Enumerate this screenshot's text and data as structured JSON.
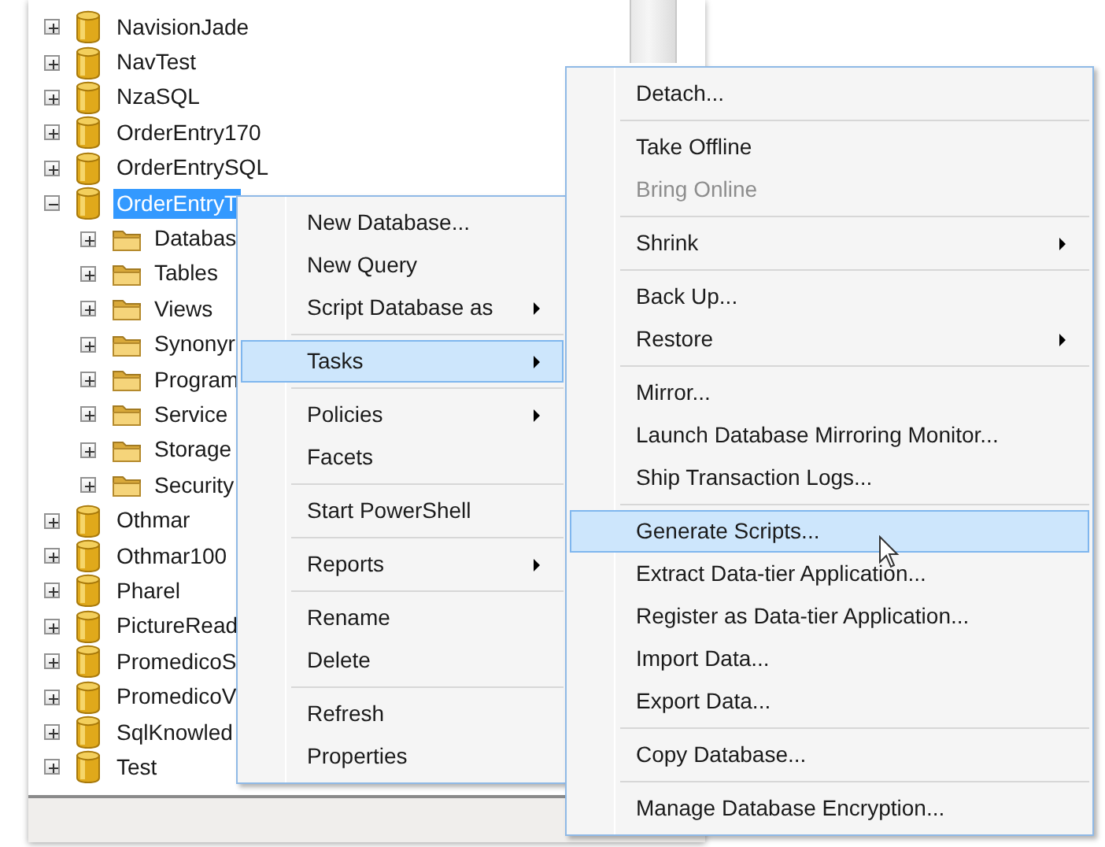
{
  "tree": [
    {
      "label": "NavisionJade",
      "kind": "database",
      "expanded": false,
      "selected": false
    },
    {
      "label": "NavTest",
      "kind": "database",
      "expanded": false,
      "selected": false
    },
    {
      "label": "NzaSQL",
      "kind": "database",
      "expanded": false,
      "selected": false
    },
    {
      "label": "OrderEntry170",
      "kind": "database",
      "expanded": false,
      "selected": false
    },
    {
      "label": "OrderEntrySQL",
      "kind": "database",
      "expanded": false,
      "selected": false
    },
    {
      "label": "OrderEntryT",
      "kind": "database",
      "expanded": true,
      "selected": true,
      "children": [
        {
          "label": "Databas",
          "kind": "folder",
          "expanded": false,
          "selected": false
        },
        {
          "label": "Tables",
          "kind": "folder",
          "expanded": false,
          "selected": false
        },
        {
          "label": "Views",
          "kind": "folder",
          "expanded": false,
          "selected": false
        },
        {
          "label": "Synonyr",
          "kind": "folder",
          "expanded": false,
          "selected": false
        },
        {
          "label": "Program",
          "kind": "folder",
          "expanded": false,
          "selected": false
        },
        {
          "label": "Service",
          "kind": "folder",
          "expanded": false,
          "selected": false
        },
        {
          "label": "Storage",
          "kind": "folder",
          "expanded": false,
          "selected": false
        },
        {
          "label": "Security",
          "kind": "folder",
          "expanded": false,
          "selected": false
        }
      ]
    },
    {
      "label": "Othmar",
      "kind": "database",
      "expanded": false,
      "selected": false
    },
    {
      "label": "Othmar100",
      "kind": "database",
      "expanded": false,
      "selected": false
    },
    {
      "label": "Pharel",
      "kind": "database",
      "expanded": false,
      "selected": false
    },
    {
      "label": "PictureRead",
      "kind": "database",
      "expanded": false,
      "selected": false
    },
    {
      "label": "PromedicoS",
      "kind": "database",
      "expanded": false,
      "selected": false
    },
    {
      "label": "PromedicoV",
      "kind": "database",
      "expanded": false,
      "selected": false
    },
    {
      "label": "SqlKnowled",
      "kind": "database",
      "expanded": false,
      "selected": false
    },
    {
      "label": "Test",
      "kind": "database",
      "expanded": false,
      "selected": false
    }
  ],
  "context_menu": [
    {
      "kind": "item",
      "label": "New Database...",
      "submenu": false,
      "selected": false,
      "disabled": false
    },
    {
      "kind": "item",
      "label": "New Query",
      "submenu": false,
      "selected": false,
      "disabled": false
    },
    {
      "kind": "item",
      "label": "Script Database as",
      "submenu": true,
      "selected": false,
      "disabled": false
    },
    {
      "kind": "separator"
    },
    {
      "kind": "item",
      "label": "Tasks",
      "submenu": true,
      "selected": true,
      "disabled": false
    },
    {
      "kind": "separator"
    },
    {
      "kind": "item",
      "label": "Policies",
      "submenu": true,
      "selected": false,
      "disabled": false
    },
    {
      "kind": "item",
      "label": "Facets",
      "submenu": false,
      "selected": false,
      "disabled": false
    },
    {
      "kind": "separator"
    },
    {
      "kind": "item",
      "label": "Start PowerShell",
      "submenu": false,
      "selected": false,
      "disabled": false
    },
    {
      "kind": "separator"
    },
    {
      "kind": "item",
      "label": "Reports",
      "submenu": true,
      "selected": false,
      "disabled": false
    },
    {
      "kind": "separator"
    },
    {
      "kind": "item",
      "label": "Rename",
      "submenu": false,
      "selected": false,
      "disabled": false
    },
    {
      "kind": "item",
      "label": "Delete",
      "submenu": false,
      "selected": false,
      "disabled": false
    },
    {
      "kind": "separator"
    },
    {
      "kind": "item",
      "label": "Refresh",
      "submenu": false,
      "selected": false,
      "disabled": false
    },
    {
      "kind": "item",
      "label": "Properties",
      "submenu": false,
      "selected": false,
      "disabled": false
    }
  ],
  "tasks_submenu": [
    {
      "kind": "item",
      "label": "Detach...",
      "submenu": false,
      "selected": false,
      "disabled": false
    },
    {
      "kind": "separator"
    },
    {
      "kind": "item",
      "label": "Take Offline",
      "submenu": false,
      "selected": false,
      "disabled": false
    },
    {
      "kind": "item",
      "label": "Bring Online",
      "submenu": false,
      "selected": false,
      "disabled": true
    },
    {
      "kind": "separator"
    },
    {
      "kind": "item",
      "label": "Shrink",
      "submenu": true,
      "selected": false,
      "disabled": false
    },
    {
      "kind": "separator"
    },
    {
      "kind": "item",
      "label": "Back Up...",
      "submenu": false,
      "selected": false,
      "disabled": false
    },
    {
      "kind": "item",
      "label": "Restore",
      "submenu": true,
      "selected": false,
      "disabled": false
    },
    {
      "kind": "separator"
    },
    {
      "kind": "item",
      "label": "Mirror...",
      "submenu": false,
      "selected": false,
      "disabled": false
    },
    {
      "kind": "item",
      "label": "Launch Database Mirroring Monitor...",
      "submenu": false,
      "selected": false,
      "disabled": false
    },
    {
      "kind": "item",
      "label": "Ship Transaction Logs...",
      "submenu": false,
      "selected": false,
      "disabled": false
    },
    {
      "kind": "separator"
    },
    {
      "kind": "item",
      "label": "Generate Scripts...",
      "submenu": false,
      "selected": true,
      "disabled": false
    },
    {
      "kind": "item",
      "label": "Extract Data-tier Application...",
      "submenu": false,
      "selected": false,
      "disabled": false
    },
    {
      "kind": "item",
      "label": "Register as Data-tier Application...",
      "submenu": false,
      "selected": false,
      "disabled": false
    },
    {
      "kind": "item",
      "label": "Import Data...",
      "submenu": false,
      "selected": false,
      "disabled": false
    },
    {
      "kind": "item",
      "label": "Export Data...",
      "submenu": false,
      "selected": false,
      "disabled": false
    },
    {
      "kind": "separator"
    },
    {
      "kind": "item",
      "label": "Copy Database...",
      "submenu": false,
      "selected": false,
      "disabled": false
    },
    {
      "kind": "separator"
    },
    {
      "kind": "item",
      "label": "Manage Database Encryption...",
      "submenu": false,
      "selected": false,
      "disabled": false
    }
  ]
}
